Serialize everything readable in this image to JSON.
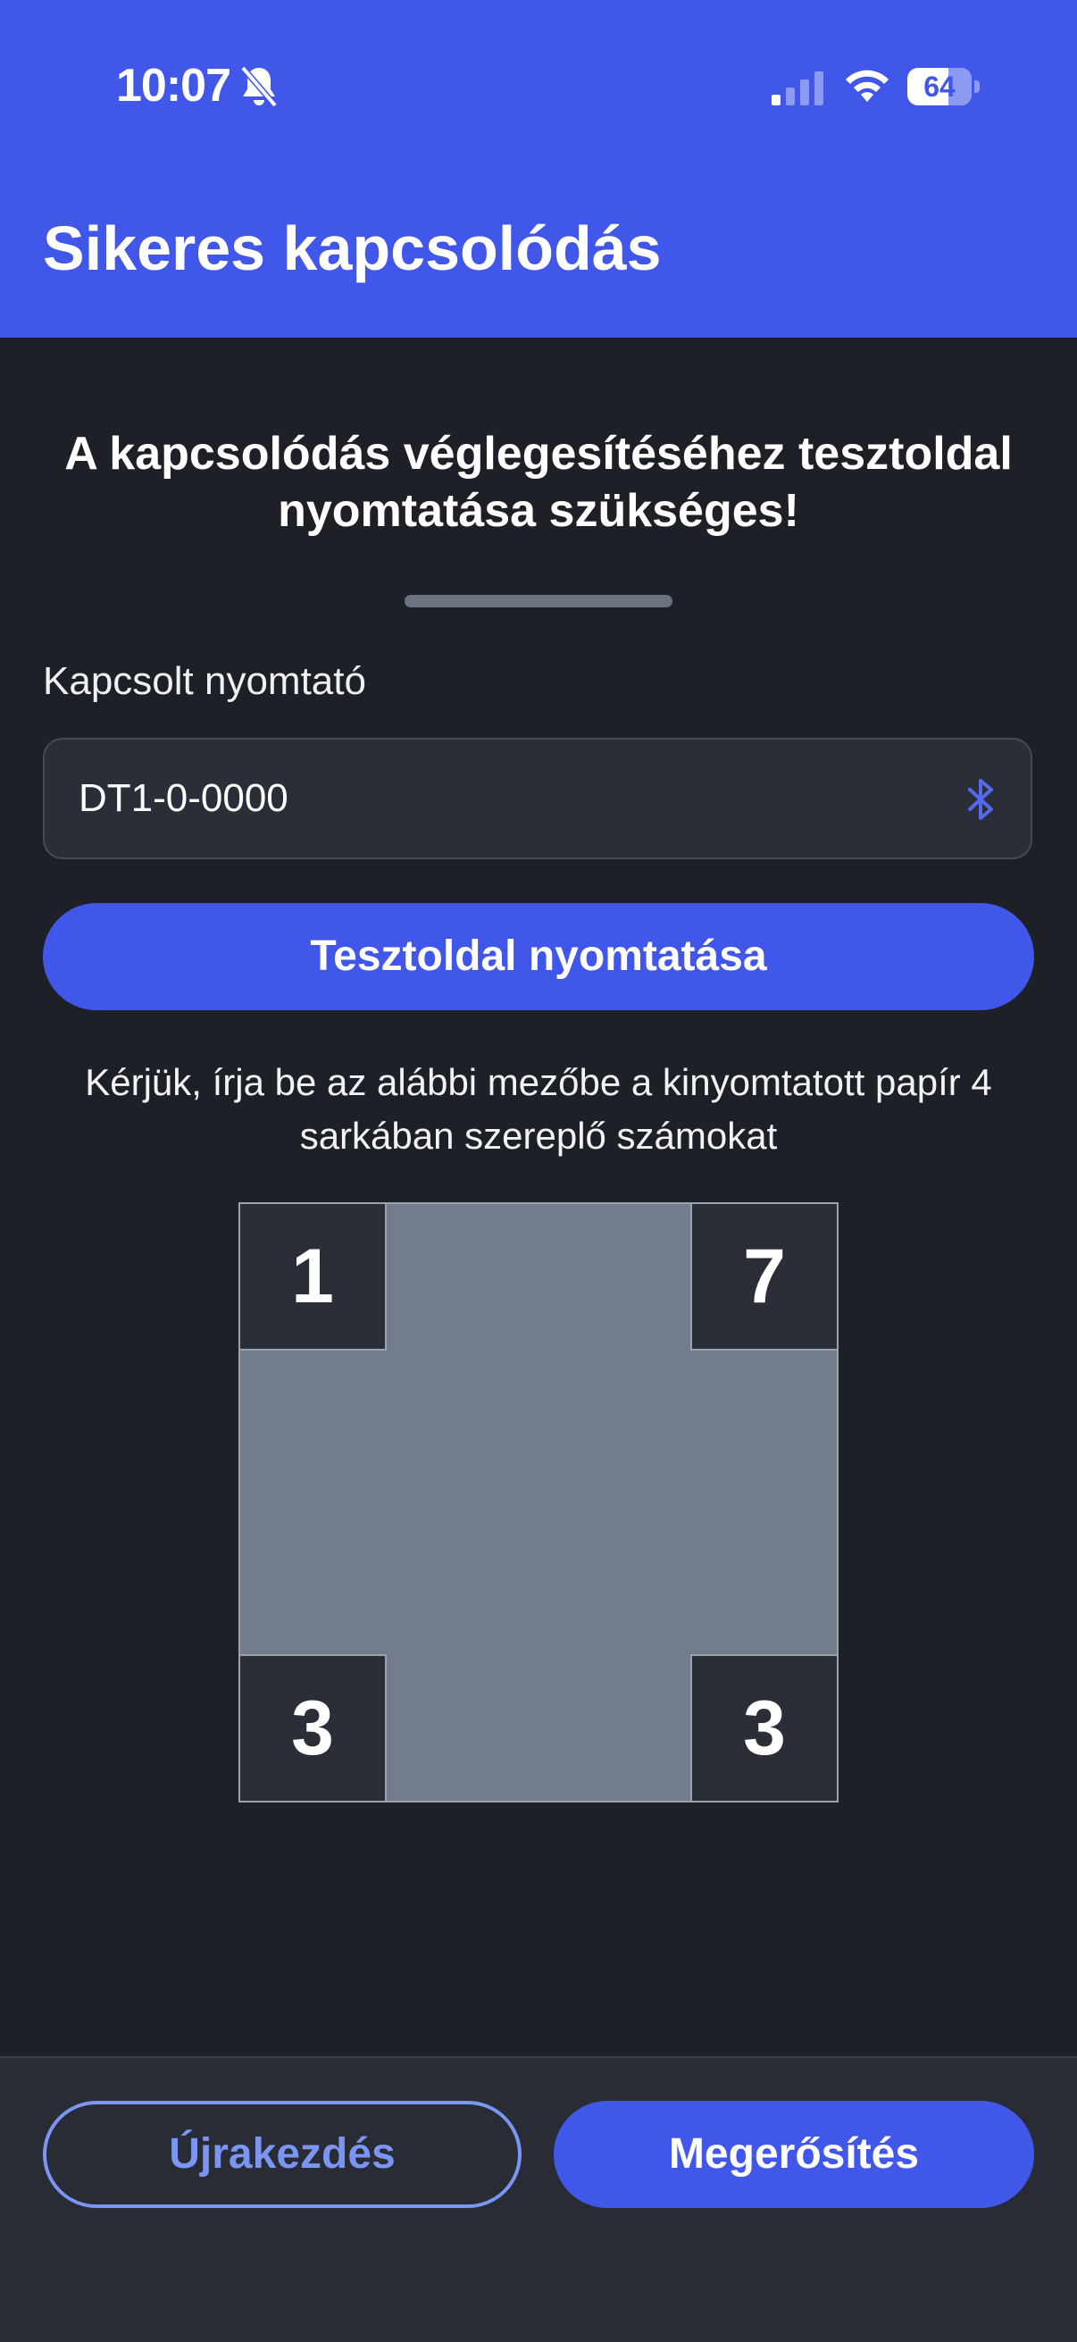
{
  "status_bar": {
    "time": "10:07",
    "battery_level": "64",
    "icons": [
      "bell-slash-icon",
      "cellular-signal-icon",
      "wifi-icon",
      "battery-icon"
    ]
  },
  "header": {
    "title": "Sikeres kapcsolódás"
  },
  "main": {
    "headline": "A kapcsolódás véglegesítéséhez tesztoldal nyomtatása szükséges!",
    "printer_label": "Kapcsolt nyomtató",
    "printer_value": "DT1-0-0000",
    "printer_icon": "bluetooth-icon",
    "print_test_button": "Tesztoldal nyomtatása",
    "instruction": "Kérjük, írja be az alábbi mezőbe a kinyomtatott papír 4 sarkában szereplő számokat",
    "corners": {
      "top_left": "1",
      "top_right": "7",
      "bottom_left": "3",
      "bottom_right": "3"
    }
  },
  "footer": {
    "restart_button": "Újrakezdés",
    "confirm_button": "Megerősítés"
  },
  "colors": {
    "accent": "#4157ea",
    "background": "#1e2027",
    "field": "#2a2e37",
    "paper": "#727c8a",
    "outline_button": "#7a95f2"
  }
}
